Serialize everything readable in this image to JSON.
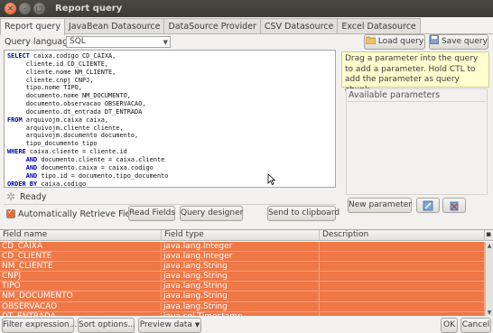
{
  "window": {
    "title": "Report query"
  },
  "tabs": [
    {
      "label": "Report query",
      "active": true
    },
    {
      "label": "JavaBean Datasource",
      "active": false
    },
    {
      "label": "DataSource Provider",
      "active": false
    },
    {
      "label": "CSV Datasource",
      "active": false
    },
    {
      "label": "Excel Datasource",
      "active": false
    }
  ],
  "query_language": {
    "label": "Query language",
    "value": "SQL"
  },
  "toolbar": {
    "load_query": "Load query",
    "save_query": "Save query"
  },
  "sql": [
    {
      "kw": "SELECT",
      "text": " caixa.codigo CD_CAIXA,"
    },
    {
      "kw": "",
      "text": "     cliente.id CD_CLIENTE,"
    },
    {
      "kw": "",
      "text": "     cliente.nome NM_CLIENTE,"
    },
    {
      "kw": "",
      "text": "     cliente.cnpj CNPJ,"
    },
    {
      "kw": "",
      "text": "     tipo.nome TIPO,"
    },
    {
      "kw": "",
      "text": "     documento.nome NM_DOCUMENTO,"
    },
    {
      "kw": "",
      "text": "     documento.observacao OBSERVACAO,"
    },
    {
      "kw": "",
      "text": "     documento.dt_entrada DT_ENTRADA"
    },
    {
      "kw": "FROM",
      "text": " arquivojm.caixa caixa,"
    },
    {
      "kw": "",
      "text": "     arquivojm.cliente cliente,"
    },
    {
      "kw": "",
      "text": "     arquivojm.documento documento,"
    },
    {
      "kw": "",
      "text": "     tipo_documento tipo"
    },
    {
      "kw": "WHERE",
      "text": " caixa.cliente = cliente.id"
    },
    {
      "kw": "     AND",
      "text": " documento.cliente = caixa.cliente"
    },
    {
      "kw": "     AND",
      "text": " documento.caixa = caixa.codigo"
    },
    {
      "kw": "     AND",
      "text": " tipo.id = documento.tipo_documento"
    },
    {
      "kw": "ORDER BY",
      "text": " caixa.codigo"
    }
  ],
  "status": {
    "text": "Ready"
  },
  "info_text": "Drag a parameter into the query to add a parameter. Hold CTL to add the parameter as query chunk.",
  "available_parameters": {
    "title": "Available parameters"
  },
  "buttons": {
    "auto_retrieve": "Automatically Retrieve Fields",
    "read_fields": "Read Fields",
    "query_designer": "Query designer",
    "send_clipboard": "Send to clipboard",
    "new_parameter": "New parameter",
    "filter_expression": "Filter expression...",
    "sort_options": "Sort options...",
    "preview_data": "Preview data",
    "ok": "OK",
    "cancel": "Cancel"
  },
  "fields_table": {
    "columns": [
      "Field name",
      "Field type",
      "Description"
    ],
    "rows": [
      [
        "CD_CAIXA",
        "java.lang.Integer",
        ""
      ],
      [
        "CD_CLIENTE",
        "java.lang.Integer",
        ""
      ],
      [
        "NM_CLIENTE",
        "java.lang.String",
        ""
      ],
      [
        "CNPJ",
        "java.lang.String",
        ""
      ],
      [
        "TIPO",
        "java.lang.String",
        ""
      ],
      [
        "NM_DOCUMENTO",
        "java.lang.String",
        ""
      ],
      [
        "OBSERVACAO",
        "java.lang.String",
        ""
      ],
      [
        "DT_ENTRADA",
        "java.sql.Timestamp",
        ""
      ]
    ]
  },
  "colors": {
    "selection": "#f07746",
    "accent": "#e1571f"
  }
}
